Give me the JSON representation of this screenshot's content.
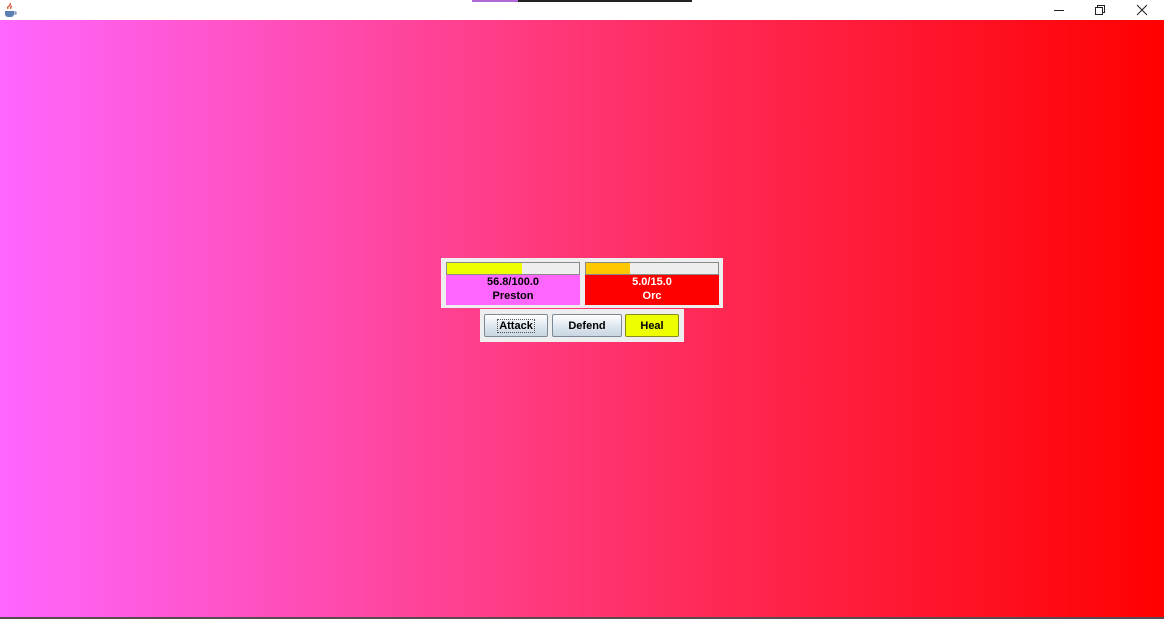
{
  "window": {
    "icon": "java-cup-icon",
    "controls": {
      "minimize": "—",
      "maximize": "❐",
      "close": "✕"
    },
    "colors": {
      "background_left": "#ff66ff",
      "background_right": "#ff0000"
    }
  },
  "player": {
    "hp_text": "56.8/100.0",
    "hp_fraction": 0.568,
    "name": "Preston",
    "panel_color": "#ff66ff",
    "bar_color": "#eeff00"
  },
  "enemy": {
    "hp_text": "5.0/15.0",
    "hp_fraction": 0.333,
    "name": "Orc",
    "panel_color": "#ff0000",
    "bar_color": "#ffc800"
  },
  "actions": {
    "attack": "Attack",
    "defend": "Defend",
    "heal": "Heal"
  }
}
